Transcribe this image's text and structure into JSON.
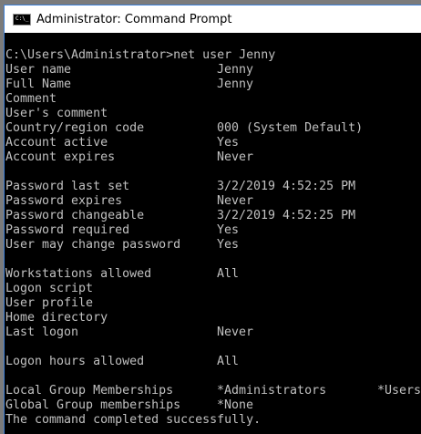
{
  "window": {
    "title": "Administrator: Command Prompt",
    "icon": "cmd-icon",
    "icon_text": "C:\\_"
  },
  "console": {
    "prompt": "C:\\Users\\Administrator>net user Jenny",
    "lines": [
      {
        "label": "User name",
        "value": "Jenny"
      },
      {
        "label": "Full Name",
        "value": "Jenny"
      },
      {
        "label": "Comment",
        "value": ""
      },
      {
        "label": "User's comment",
        "value": ""
      },
      {
        "label": "Country/region code",
        "value": "000 (System Default)"
      },
      {
        "label": "Account active",
        "value": "Yes"
      },
      {
        "label": "Account expires",
        "value": "Never"
      },
      {
        "label": "",
        "value": ""
      },
      {
        "label": "Password last set",
        "value": "3/2/2019 4:52:25 PM"
      },
      {
        "label": "Password expires",
        "value": "Never"
      },
      {
        "label": "Password changeable",
        "value": "3/2/2019 4:52:25 PM"
      },
      {
        "label": "Password required",
        "value": "Yes"
      },
      {
        "label": "User may change password",
        "value": "Yes"
      },
      {
        "label": "",
        "value": ""
      },
      {
        "label": "Workstations allowed",
        "value": "All"
      },
      {
        "label": "Logon script",
        "value": ""
      },
      {
        "label": "User profile",
        "value": ""
      },
      {
        "label": "Home directory",
        "value": ""
      },
      {
        "label": "Last logon",
        "value": "Never"
      },
      {
        "label": "",
        "value": ""
      },
      {
        "label": "Logon hours allowed",
        "value": "All"
      },
      {
        "label": "",
        "value": ""
      },
      {
        "label": "Local Group Memberships",
        "value": "*Administrators",
        "value2": "*Users"
      },
      {
        "label": "Global Group memberships",
        "value": "*None"
      },
      {
        "label": "The command completed successfully.",
        "value": ""
      }
    ]
  }
}
